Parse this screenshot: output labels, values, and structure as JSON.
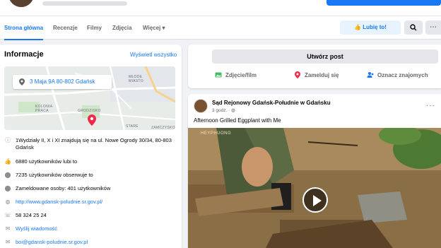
{
  "header": {
    "tabs": [
      {
        "label": "Strona główna",
        "active": true
      },
      {
        "label": "Recenzje"
      },
      {
        "label": "Filmy"
      },
      {
        "label": "Zdjęcia"
      },
      {
        "label": "Więcej ▾"
      }
    ],
    "like_button": "Lubię to!",
    "search_icon": "search-icon",
    "more_icon": "more-horizontal-icon"
  },
  "info": {
    "title": "Informacje",
    "see_all": "Wyświetl wszystko",
    "map": {
      "address": "3 Maja 9A 80-802 Gdańsk",
      "labels": [
        "MŁODE MIASTO",
        "KOLONIA PRACA",
        "GRODZISKO",
        "STARE",
        "ZAMCZYSKO"
      ]
    },
    "rows": [
      {
        "icon": "info-icon",
        "text": "1Wydziały II, X i XI znajdują się na ul. Nowe Ogrody 30/34, 80-803 Gdańsk"
      },
      {
        "icon": "thumbs-up-icon",
        "text": "6880 użytkowników lubi to"
      },
      {
        "icon": "followers-icon",
        "text": "7235 użytkowników obserwuje to"
      },
      {
        "icon": "location-icon",
        "text": "Zameldowane osoby: 401 użytkowników"
      },
      {
        "icon": "globe-icon",
        "text": "http://www.gdansk-poludnie.sr.gov.pl/",
        "link": true
      },
      {
        "icon": "phone-icon",
        "text": "58 324 25 24"
      },
      {
        "icon": "messenger-icon",
        "text": "Wyślij wiadomość",
        "link": true
      },
      {
        "icon": "email-icon",
        "text": "boi@gdansk-poludnie.sr.gov.pl",
        "link": true
      }
    ]
  },
  "composer": {
    "create_post": "Utwórz post",
    "actions": [
      {
        "label": "Zdjęcie/film",
        "color": "#45bd62"
      },
      {
        "label": "Zamelduj się",
        "color": "#f02849"
      },
      {
        "label": "Oznacz znajomych",
        "color": "#1877f2"
      }
    ]
  },
  "post": {
    "author": "Sąd Rejonowy Gdańsk-Południe w Gdańsku",
    "time": "3 godz. · ",
    "text": "Afternoon Grilled Eggplant with Me",
    "video_watermark": "HEYPHUONG"
  },
  "colors": {
    "accent": "#1877f2",
    "background": "#f0f2f5"
  }
}
